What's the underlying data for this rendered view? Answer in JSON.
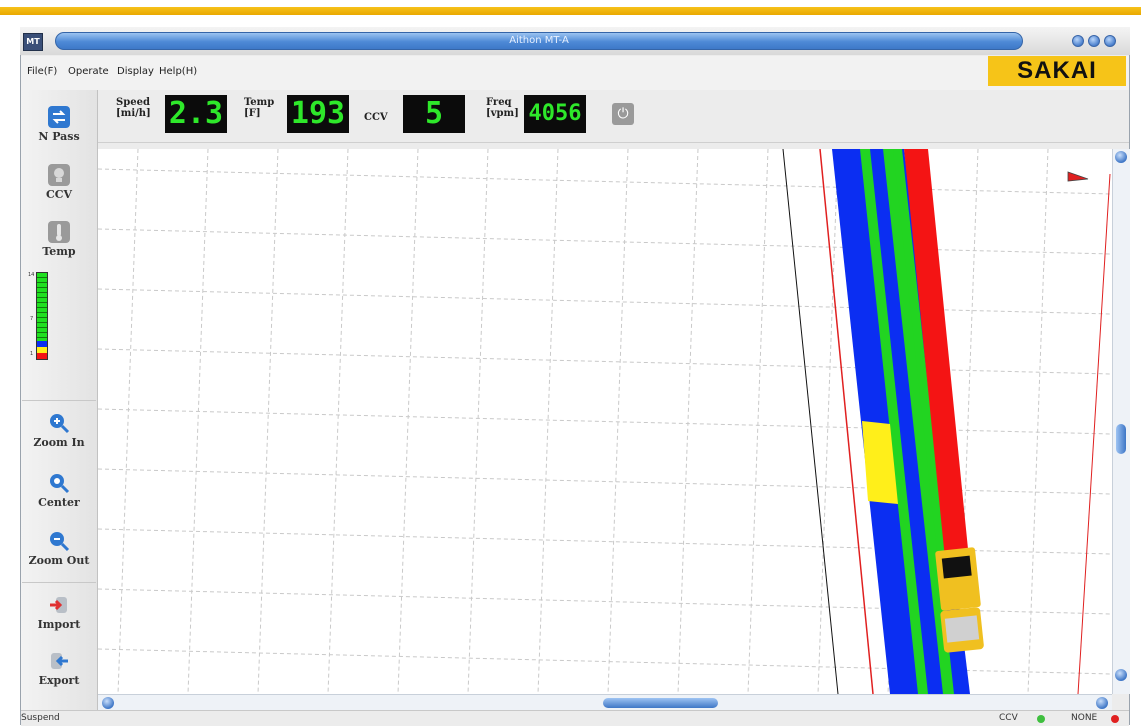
{
  "window": {
    "app_badge": "MT",
    "title": "Aithon MT-A"
  },
  "menu": {
    "items": [
      "File(F)",
      "Operate",
      "Display",
      "Help(H)"
    ]
  },
  "brand": {
    "logo": "SAKAI",
    "logo_color": "#f6c418"
  },
  "sidebar": {
    "n_pass": "N Pass",
    "ccv": "CCV",
    "temp": "Temp",
    "scale_labels": [
      "14",
      "7",
      "1"
    ],
    "zoom_in": "Zoom In",
    "center": "Center",
    "zoom_out": "Zoom Out",
    "import": "Import",
    "export": "Export",
    "icons": [
      "swap-arrows-icon",
      "ccv-icon",
      "thermometer-icon",
      "zoom-in-icon",
      "center-icon",
      "zoom-out-icon",
      "import-icon",
      "export-icon"
    ]
  },
  "gauges": {
    "speed_label_1": "Speed",
    "speed_label_2": "[mi/h]",
    "speed_value": "2.3",
    "temp_label_1": "Temp",
    "temp_label_2": "[F]",
    "temp_value": "193",
    "ccv_label": "CCV",
    "ccv_value": "5",
    "freq_label_1": "Freq",
    "freq_label_2": "[vpm]",
    "freq_value": "4056",
    "display_color": "#2ee82a"
  },
  "status": {
    "left": "Suspend",
    "ccv_label": "CCV",
    "ccv_color": "#3fbf3f",
    "mode_label": "NONE",
    "mode_color": "#e02020"
  },
  "colors": {
    "pass_blue": "#0b2ef2",
    "pass_green": "#22d421",
    "pass_red": "#f41414",
    "pass_yellow": "#ffef1a"
  }
}
